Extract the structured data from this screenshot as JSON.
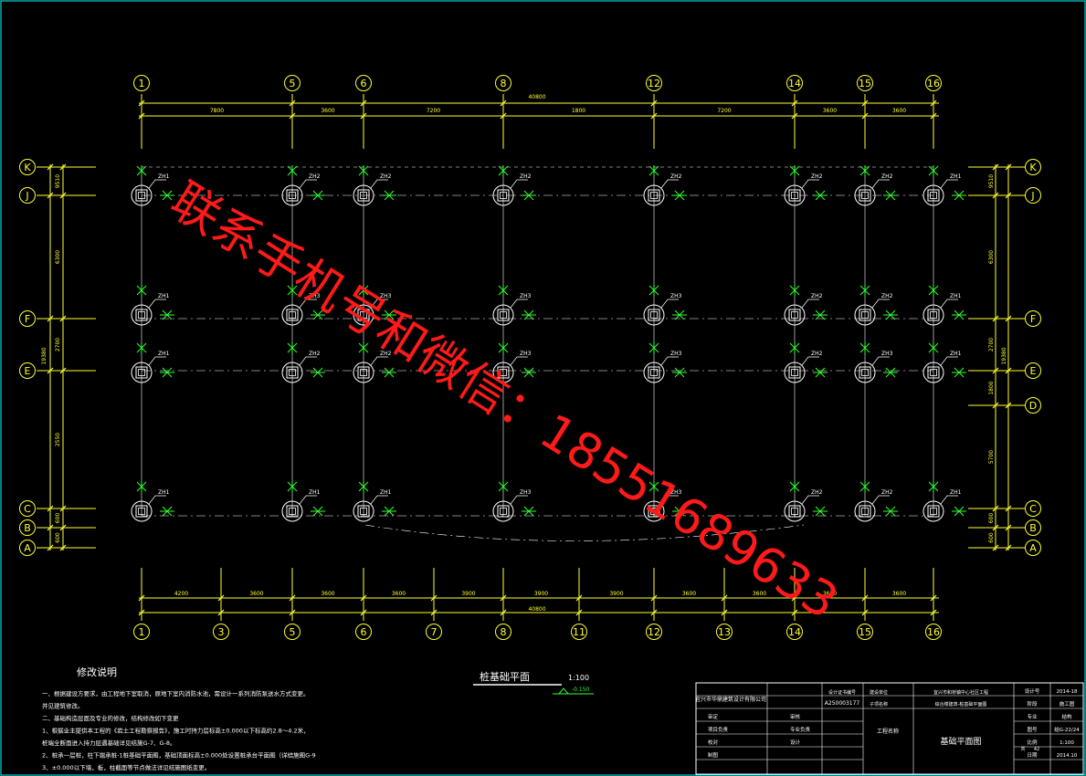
{
  "colors": {
    "background": "#000000",
    "grid_line": "#ffffff",
    "dim_line": "#ffff33",
    "axis_bubble": "#ffff33",
    "pile": "#ffffff",
    "marker": "#33ff33",
    "watermark": "#ff1a1a",
    "titleblock": "#ffffff",
    "border": "#00ffff"
  },
  "axes_top": [
    "1",
    "5",
    "6",
    "8",
    "12",
    "14",
    "15",
    "16"
  ],
  "axes_bottom": [
    "1",
    "3",
    "5",
    "6",
    "7",
    "8",
    "11",
    "12",
    "13",
    "14",
    "15",
    "16"
  ],
  "axes_left": [
    "K",
    "J",
    "F",
    "E",
    "C",
    "B",
    "A"
  ],
  "axes_right": [
    "K",
    "J",
    "F",
    "E",
    "D",
    "C",
    "B",
    "A"
  ],
  "dims_top": [
    "7800",
    "3600",
    "7200",
    "1800",
    "7200",
    "3600",
    "3600"
  ],
  "dims_top_total": "40800",
  "dims_bottom": [
    "4200",
    "3600",
    "3600",
    "3600",
    "3900",
    "3900",
    "3900",
    "3600",
    "3600",
    "3600",
    "3600"
  ],
  "dims_bottom_total": "40800",
  "dims_left": [
    "9510",
    "6300",
    "2700",
    "2550",
    "600",
    "600"
  ],
  "dims_left_total": "19380",
  "dims_right": [
    "9510",
    "6300",
    "2700",
    "1800",
    "5700",
    "600",
    "600"
  ],
  "dims_right_total": "19380",
  "pile_labels": [
    "ZH1",
    "ZH2",
    "ZH3"
  ],
  "watermark_text": "联系手机号和微信：18551689633",
  "plan_title": "桩基础平面",
  "plan_scale": "1:100",
  "elevation_mark": "-0.150",
  "notes_title": "修改说明",
  "notes": [
    "一、根据建设方要求，由工程地下室取消，原地下室内消防水池，需设计一系列消防泵送水方式变更。",
    "    并见建筑修改。",
    "二、基础构造层面及专业的修改，结构修改如下变更",
    "1、根据业主提供本工程的《岩土工程勘察报告》，施工时持力层标高±0.000以下标高约2.8～4.2米，",
    "    桩端全断面进入持力层遇基础详见结施G-7、G-8。",
    "2、桩承一层桩，柱下端承桩-1桩基础平面图，基础顶面标高±0.000处设置桩承台平面图（详结施图G-9",
    "3、±0.000以下墙，板，柱截面等节点做法详见结施图纸变更。"
  ],
  "title_block": {
    "company": "宜兴市华鼎建筑设计有限公司",
    "cert_label": "设计证书编号",
    "cert_no": "A250003177",
    "project_label": "建设单位",
    "project_name": "工程名称",
    "project_value": "宜兴市和桥镇中心社区工程",
    "sub_label": "子项名称",
    "sub_value": "综合楼建筑-桩基础平面图",
    "drawing_title": "基础平面图",
    "roles": [
      "审定",
      "审核",
      "项目负责",
      "专业负责",
      "校对",
      "设计",
      "制图"
    ],
    "role_values": [
      "审定",
      "审核",
      "项目负责",
      "专业负责",
      "校对",
      "设计",
      "制图"
    ],
    "design_no_label": "设计号",
    "design_no": "2014-18",
    "stage_label": "阶段",
    "stage": "施工图",
    "discipline_label": "专业",
    "discipline": "结构",
    "drawing_no_label": "图号",
    "drawing_no": "结G-22/24",
    "scale_label": "比例",
    "scale": "1:100",
    "date_label": "日期",
    "date": "2014.10",
    "page_label": "共",
    "page": "42"
  }
}
